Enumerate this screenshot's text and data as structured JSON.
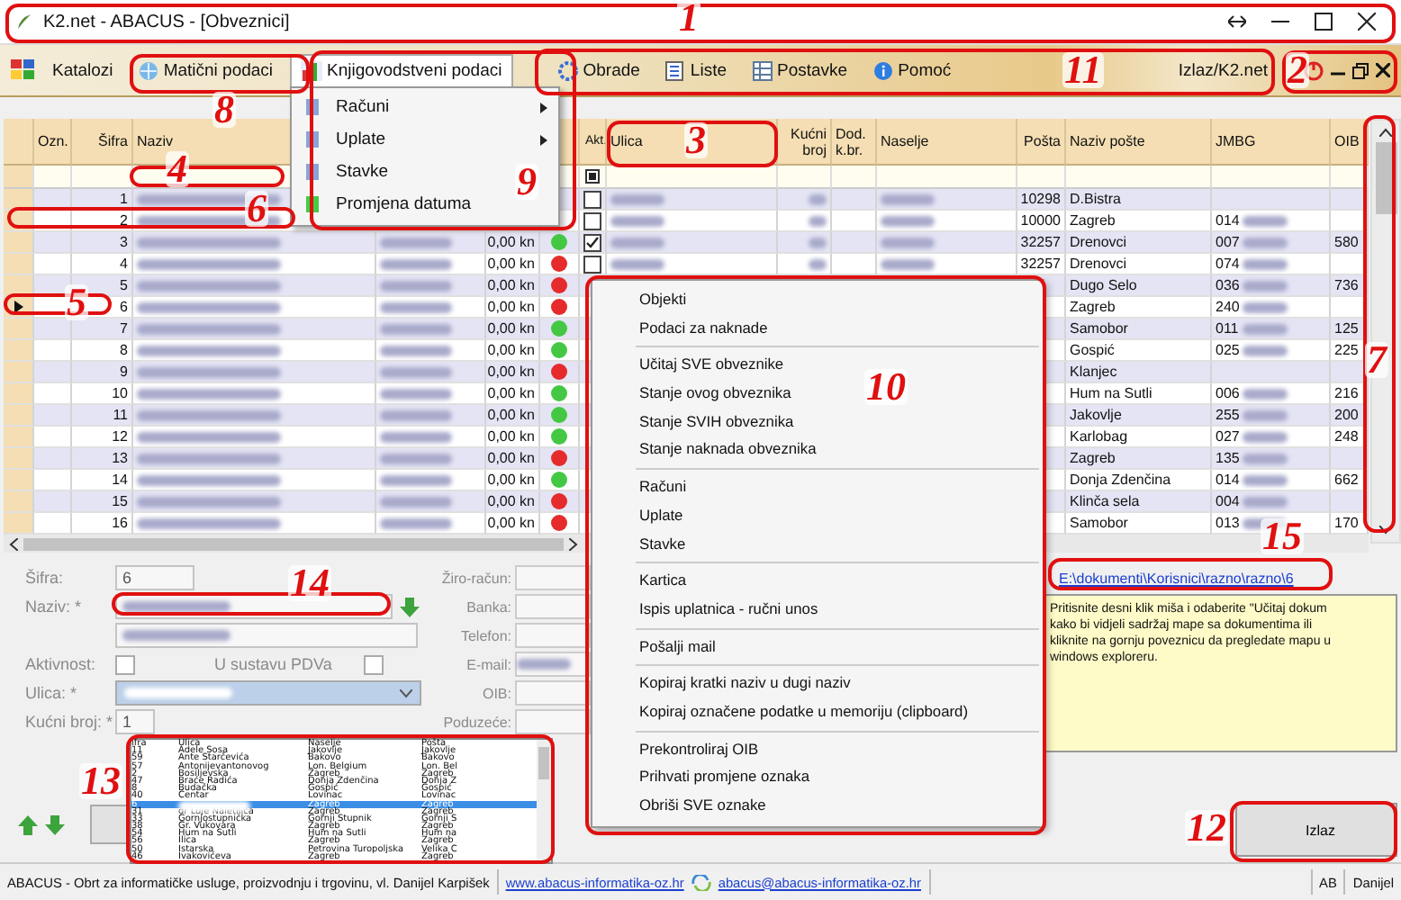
{
  "window": {
    "title": "K2.net - ABACUS - [Obveznici]"
  },
  "menu_bar": {
    "items": [
      {
        "label": "Katalozi",
        "selected": false
      },
      {
        "label": "Matični podaci",
        "selected": false
      },
      {
        "label": "Knjigovodstveni podaci",
        "selected": true
      },
      {
        "label": "Obrade",
        "selected": false
      },
      {
        "label": "Liste",
        "selected": false
      },
      {
        "label": "Postavke",
        "selected": false
      },
      {
        "label": "Pomoć",
        "selected": false
      }
    ],
    "exit_label": "Izlaz/K2.net"
  },
  "accounting_menu": {
    "items": [
      {
        "label": "Računi",
        "submenu": true
      },
      {
        "label": "Uplate",
        "submenu": true
      },
      {
        "label": "Stavke",
        "submenu": false
      },
      {
        "label": "Promjena datuma",
        "submenu": false
      }
    ]
  },
  "grid": {
    "columns": [
      "Ozn.",
      "Šifra",
      "Naziv",
      "Akt.",
      "Ulica",
      "Kućni broj",
      "Dod. k.br.",
      "Naselje",
      "Pošta",
      "Naziv pošte",
      "JMBG",
      "OIB"
    ],
    "rows": [
      {
        "sifra": "1",
        "akt": false,
        "posta": "10298",
        "naziv_poste": "D.Bistra",
        "selected": false
      },
      {
        "sifra": "2",
        "akt": false,
        "posta": "10000",
        "naziv_poste": "Zagreb",
        "jmbg": "014",
        "selected": false
      },
      {
        "sifra": "3",
        "amount": "0,00 kn",
        "color": "#44c844",
        "akt": true,
        "posta": "32257",
        "naziv_poste": "Drenovci",
        "jmbg": "007",
        "oib": "580",
        "selected": false
      },
      {
        "sifra": "4",
        "amount": "0,00 kn",
        "color": "#e52b2b",
        "akt": false,
        "posta": "32257",
        "naziv_poste": "Drenovci",
        "jmbg": "074",
        "selected": false
      },
      {
        "sifra": "5",
        "amount": "0,00 kn",
        "color": "#e52b2b",
        "naziv_poste": "Dugo Selo",
        "jmbg": "036",
        "oib": "736",
        "selected": false
      },
      {
        "sifra": "6",
        "amount": "0,00 kn",
        "color": "#e52b2b",
        "naziv_poste": "Zagreb",
        "jmbg": "240",
        "selected": true
      },
      {
        "sifra": "7",
        "amount": "0,00 kn",
        "color": "#44c844",
        "naziv_poste": "Samobor",
        "jmbg": "011",
        "oib": "125",
        "selected": false
      },
      {
        "sifra": "8",
        "amount": "0,00 kn",
        "color": "#44c844",
        "naziv_poste": "Gospić",
        "jmbg": "025",
        "oib": "225",
        "selected": false
      },
      {
        "sifra": "9",
        "amount": "0,00 kn",
        "color": "#e52b2b",
        "naziv_poste": "Klanjec",
        "selected": false
      },
      {
        "sifra": "10",
        "amount": "0,00 kn",
        "color": "#44c844",
        "naziv_poste": "Hum na Sutli",
        "jmbg": "006",
        "oib": "216",
        "selected": false
      },
      {
        "sifra": "11",
        "amount": "0,00 kn",
        "color": "#44c844",
        "naziv_poste": "Jakovlje",
        "jmbg": "255",
        "oib": "200",
        "selected": false
      },
      {
        "sifra": "12",
        "amount": "0,00 kn",
        "color": "#44c844",
        "naziv_poste": "Karlobag",
        "jmbg": "027",
        "oib": "248",
        "selected": false
      },
      {
        "sifra": "13",
        "amount": "0,00 kn",
        "color": "#e52b2b",
        "naziv_poste": "Zagreb",
        "jmbg": "135",
        "selected": false
      },
      {
        "sifra": "14",
        "amount": "0,00 kn",
        "color": "#44c844",
        "naziv_poste": "Donja Zdenčina",
        "jmbg": "014",
        "oib": "662",
        "selected": false
      },
      {
        "sifra": "15",
        "amount": "0,00 kn",
        "color": "#e52b2b",
        "naziv_poste": "Klinča sela",
        "jmbg": "004",
        "selected": false
      },
      {
        "sifra": "16",
        "amount": "0,00 kn",
        "color": "#e52b2b",
        "naziv_poste": "Samobor",
        "jmbg": "013",
        "oib": "170",
        "selected": false
      }
    ]
  },
  "context_menu": {
    "groups": [
      [
        "Objekti",
        "Podaci za naknade"
      ],
      [
        "Učitaj SVE obveznike",
        "Stanje ovog obveznika",
        "Stanje SVIH obveznika",
        "Stanje naknada obveznika"
      ],
      [
        "Računi",
        "Uplate",
        "Stavke"
      ],
      [
        "Kartica",
        "Ispis uplatnica - ručni unos"
      ],
      [
        "Pošalji mail"
      ],
      [
        "Kopiraj kratki naziv u dugi naziv",
        "Kopiraj označene podatke u memoriju (clipboard)"
      ],
      [
        "Prekontroliraj OIB",
        "Prihvati promjene oznaka",
        "Obriši SVE oznake"
      ]
    ]
  },
  "form": {
    "sifra_label": "Šifra:",
    "sifra": "6",
    "naziv_label": "Naziv: *",
    "aktivnost_label": "Aktivnost:",
    "aktivnost": false,
    "pdv_label": "U sustavu PDVa",
    "pdv": false,
    "ulica_label": "Ulica: *",
    "kucni_broj_label": "Kućni broj: *",
    "kucni_broj": "1",
    "side_labels": [
      "Žiro-račun:",
      "Banka:",
      "Telefon:",
      "E-mail:",
      "OIB:",
      "Poduzeće:"
    ]
  },
  "street_list": {
    "columns": [
      "ifra",
      "Ulica",
      "Naselje",
      "Pošta"
    ],
    "rows": [
      {
        "sifra": "11",
        "ulica": "Adele Sosa",
        "naselje": "Jakovlje",
        "posta": "Jakovlje",
        "selected": false
      },
      {
        "sifra": "59",
        "ulica": "Ante Starčevića",
        "naselje": "Bakovo",
        "posta": "Bakovo",
        "selected": false
      },
      {
        "sifra": "57",
        "ulica": "Antonijevantonovog",
        "naselje": "Lon. Belgium",
        "posta": "Lon. Bel",
        "selected": false
      },
      {
        "sifra": "2",
        "ulica": "Bosiljevska",
        "naselje": "Zagreb",
        "posta": "Zagreb",
        "selected": false
      },
      {
        "sifra": "47",
        "ulica": "Braće Radića",
        "naselje": "Donja Zdenčina",
        "posta": "Donja Z",
        "selected": false
      },
      {
        "sifra": "8",
        "ulica": "Budačka",
        "naselje": "Gospić",
        "posta": "Gospić",
        "selected": false
      },
      {
        "sifra": "40",
        "ulica": "Centar",
        "naselje": "Lovinac",
        "posta": "Lovinac",
        "selected": false
      },
      {
        "sifra": "6",
        "naselje": "Zagreb",
        "posta": "Zagreb",
        "selected": true
      },
      {
        "sifra": "31",
        "ulica": "dr Luje Naletilića",
        "naselje": "Zagreb",
        "posta": "Zagreb",
        "selected": false
      },
      {
        "sifra": "33",
        "ulica": "Gornjostupnička",
        "naselje": "Gornji Stupnik",
        "posta": "Gornji S",
        "selected": false
      },
      {
        "sifra": "38",
        "ulica": "Gr. Vukovara",
        "naselje": "Zagreb",
        "posta": "Zagreb",
        "selected": false
      },
      {
        "sifra": "54",
        "ulica": "Hum na Sutli",
        "naselje": "Hum na Sutli",
        "posta": "Hum na",
        "selected": false
      },
      {
        "sifra": "56",
        "ulica": "Ilica",
        "naselje": "Zagreb",
        "posta": "Zagreb",
        "selected": false
      },
      {
        "sifra": "50",
        "ulica": "Istarska",
        "naselje": "Petrovina Turopoljska",
        "posta": "Velika C",
        "selected": false
      },
      {
        "sifra": "46",
        "ulica": "Ivakovićeva",
        "naselje": "Zagreb",
        "posta": "Zagreb",
        "selected": false
      }
    ]
  },
  "documents": {
    "link": "E:\\dokumenti\\Korisnici\\razno\\razno\\6",
    "note_lines": [
      "Pritisnite desni klik miša i odaberite \"Učitaj dokum",
      "kako bi vidjeli sadržaj mape sa dokumentima ili",
      "kliknite na gornju poveznicu da pregledate mapu u",
      "windows exploreru."
    ]
  },
  "exit_button": "Izlaz",
  "status_bar": {
    "company": "ABACUS - Obrt za informatičke usluge, proizvodnju i trgovinu, vl. Danijel Karpišek",
    "website": "www.abacus-informatika-oz.hr",
    "email": "abacus@abacus-informatika-oz.hr",
    "user_code": "AB",
    "user": "Danijel"
  },
  "callouts": [
    "1",
    "2",
    "3",
    "4",
    "5",
    "6",
    "7",
    "8",
    "9",
    "10",
    "11",
    "12",
    "13",
    "14",
    "15"
  ]
}
